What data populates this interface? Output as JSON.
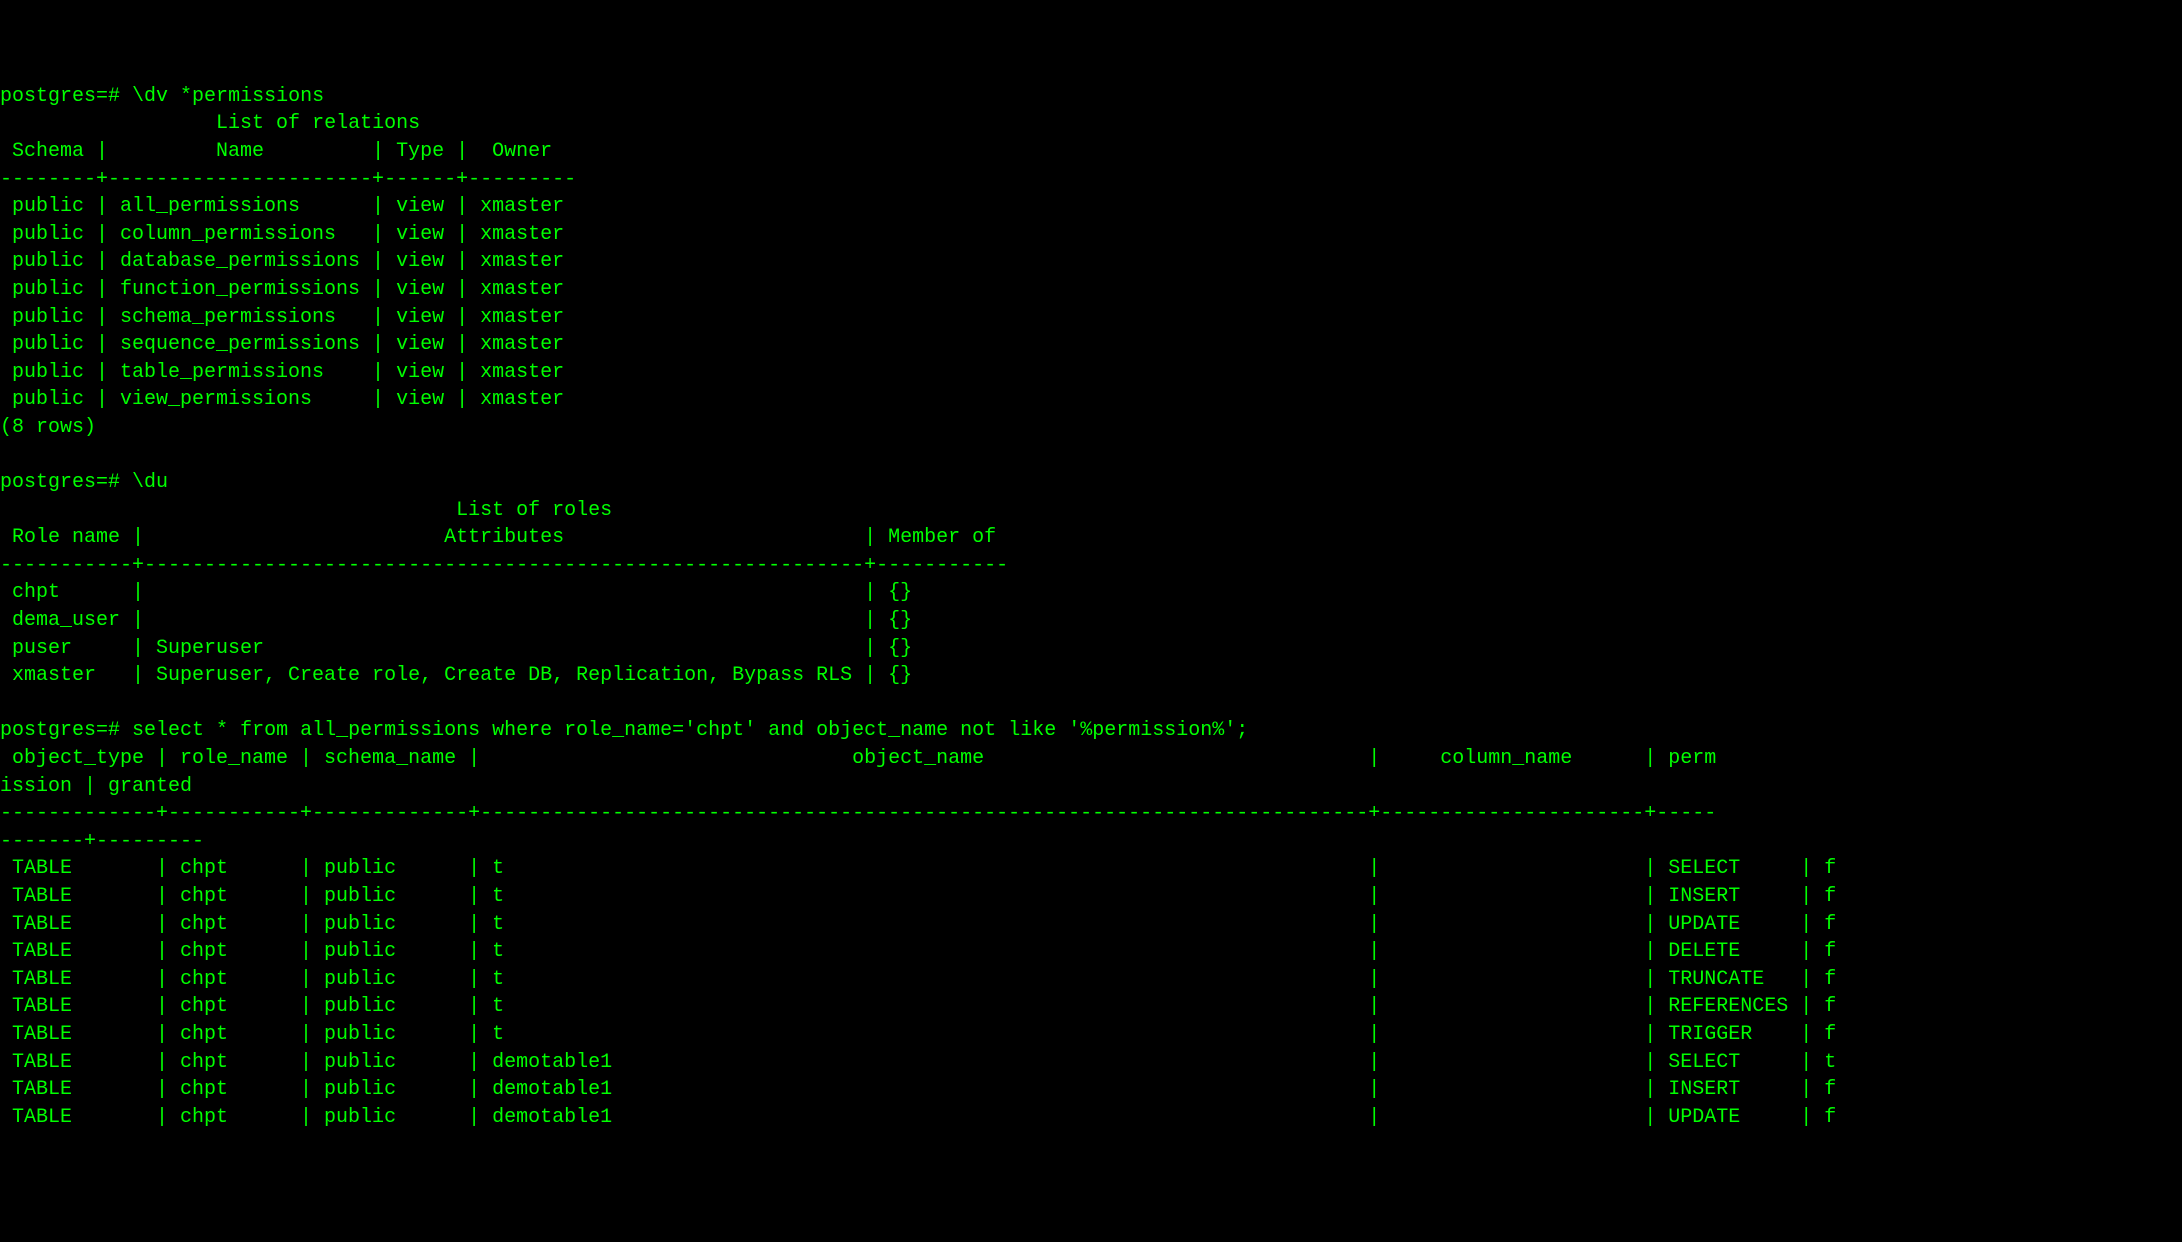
{
  "prompt": "postgres=#",
  "commands": {
    "cmd1": "\\dv *permissions",
    "cmd2": "\\du",
    "cmd3": "select * from all_permissions where role_name='chpt' and object_name not like '%permission%';"
  },
  "relations": {
    "title": "List of relations",
    "headers": [
      "Schema",
      "Name",
      "Type",
      "Owner"
    ],
    "rows": [
      {
        "schema": "public",
        "name": "all_permissions",
        "type": "view",
        "owner": "xmaster"
      },
      {
        "schema": "public",
        "name": "column_permissions",
        "type": "view",
        "owner": "xmaster"
      },
      {
        "schema": "public",
        "name": "database_permissions",
        "type": "view",
        "owner": "xmaster"
      },
      {
        "schema": "public",
        "name": "function_permissions",
        "type": "view",
        "owner": "xmaster"
      },
      {
        "schema": "public",
        "name": "schema_permissions",
        "type": "view",
        "owner": "xmaster"
      },
      {
        "schema": "public",
        "name": "sequence_permissions",
        "type": "view",
        "owner": "xmaster"
      },
      {
        "schema": "public",
        "name": "table_permissions",
        "type": "view",
        "owner": "xmaster"
      },
      {
        "schema": "public",
        "name": "view_permissions",
        "type": "view",
        "owner": "xmaster"
      }
    ],
    "footer": "(8 rows)"
  },
  "roles": {
    "title": "List of roles",
    "headers": [
      "Role name",
      "Attributes",
      "Member of"
    ],
    "rows": [
      {
        "role": "chpt",
        "attrs": "",
        "member": "{}"
      },
      {
        "role": "dema_user",
        "attrs": "",
        "member": "{}"
      },
      {
        "role": "puser",
        "attrs": "Superuser",
        "member": "{}"
      },
      {
        "role": "xmaster",
        "attrs": "Superuser, Create role, Create DB, Replication, Bypass RLS",
        "member": "{}"
      }
    ]
  },
  "query": {
    "headers_line1": " object_type | role_name | schema_name |                               object_name                                |     column_name      | perm",
    "headers_line2": "ission | granted ",
    "rows": [
      {
        "otype": "TABLE",
        "role": "chpt",
        "schema": "public",
        "obj": "t",
        "col": "",
        "perm": "SELECT",
        "granted": "f"
      },
      {
        "otype": "TABLE",
        "role": "chpt",
        "schema": "public",
        "obj": "t",
        "col": "",
        "perm": "INSERT",
        "granted": "f"
      },
      {
        "otype": "TABLE",
        "role": "chpt",
        "schema": "public",
        "obj": "t",
        "col": "",
        "perm": "UPDATE",
        "granted": "f"
      },
      {
        "otype": "TABLE",
        "role": "chpt",
        "schema": "public",
        "obj": "t",
        "col": "",
        "perm": "DELETE",
        "granted": "f"
      },
      {
        "otype": "TABLE",
        "role": "chpt",
        "schema": "public",
        "obj": "t",
        "col": "",
        "perm": "TRUNCATE",
        "granted": "f"
      },
      {
        "otype": "TABLE",
        "role": "chpt",
        "schema": "public",
        "obj": "t",
        "col": "",
        "perm": "REFERENCES",
        "granted": "f"
      },
      {
        "otype": "TABLE",
        "role": "chpt",
        "schema": "public",
        "obj": "t",
        "col": "",
        "perm": "TRIGGER",
        "granted": "f"
      },
      {
        "otype": "TABLE",
        "role": "chpt",
        "schema": "public",
        "obj": "demotable1",
        "col": "",
        "perm": "SELECT",
        "granted": "t"
      },
      {
        "otype": "TABLE",
        "role": "chpt",
        "schema": "public",
        "obj": "demotable1",
        "col": "",
        "perm": "INSERT",
        "granted": "f"
      },
      {
        "otype": "TABLE",
        "role": "chpt",
        "schema": "public",
        "obj": "demotable1",
        "col": "",
        "perm": "UPDATE",
        "granted": "f"
      }
    ]
  }
}
